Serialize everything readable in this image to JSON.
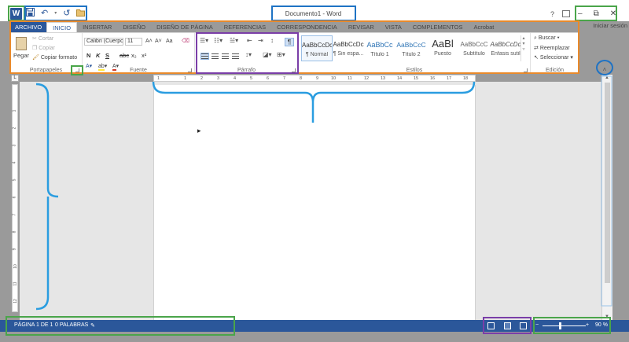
{
  "titlebar": {
    "title": "Documento1 - Word",
    "help": "?",
    "signin": "Iniciar sesión",
    "app_logo": "W",
    "qat_icons": [
      "save-icon",
      "undo-icon",
      "redo-icon",
      "open-folder-icon"
    ],
    "window_buttons": [
      "minimize-icon",
      "restore-icon",
      "close-icon"
    ]
  },
  "tabs": [
    "ARCHIVO",
    "INICIO",
    "INSERTAR",
    "DISEÑO",
    "DISEÑO DE PÁGINA",
    "REFERENCIAS",
    "CORRESPONDENCIA",
    "REVISAR",
    "VISTA",
    "COMPLEMENTOS",
    "Acrobat"
  ],
  "active_tab": "INICIO",
  "ribbon": {
    "clipboard": {
      "label": "Portapapeles",
      "paste": "Pegar",
      "cut": "Cortar",
      "copy": "Copiar",
      "format_painter": "Copiar formato"
    },
    "font": {
      "label": "Fuente",
      "font_name": "Calibri (Cuerpo)",
      "font_size": "11",
      "grow": "A˄",
      "shrink": "A˅",
      "case": "Aa",
      "bold": "N",
      "italic": "K",
      "underline": "S",
      "strike": "abc",
      "subscript": "x₂",
      "superscript": "x²"
    },
    "paragraph": {
      "label": "Párrafo",
      "pilcrow": "¶"
    },
    "styles": {
      "label": "Estilos",
      "items": [
        {
          "sample": "AaBbCcDc",
          "name": "¶ Normal"
        },
        {
          "sample": "AaBbCcDc",
          "name": "¶ Sin espa..."
        },
        {
          "sample": "AaBbCc",
          "name": "Título 1"
        },
        {
          "sample": "AaBbCcC",
          "name": "Título 2"
        },
        {
          "sample": "AaBl",
          "name": "Puesto"
        },
        {
          "sample": "AaBbCcC",
          "name": "Subtítulo"
        },
        {
          "sample": "AaBbCcDc",
          "name": "Énfasis sutil"
        }
      ]
    },
    "editing": {
      "label": "Edición",
      "find": "Buscar",
      "replace": "Reemplazar",
      "select": "Seleccionar"
    }
  },
  "ruler": {
    "h_ticks": [
      "1",
      "1",
      "2",
      "3",
      "4",
      "5",
      "6",
      "7",
      "8",
      "9",
      "10",
      "11",
      "12",
      "13",
      "14",
      "15",
      "16",
      "17",
      "18"
    ],
    "v_ticks": [
      "1",
      "2",
      "3",
      "4",
      "5",
      "6",
      "7",
      "8",
      "9",
      "10",
      "11",
      "12"
    ]
  },
  "statusbar": {
    "page": "PÁGINA 1 DE 1",
    "words": "0 PALABRAS",
    "zoom_minus": "−",
    "zoom_plus": "+",
    "zoom": "90 %"
  },
  "colors": {
    "accent": "#2b579a",
    "annotation_green": "#4aa54a",
    "annotation_blue": "#1f73c4",
    "annotation_orange": "#e98a2b",
    "annotation_purple": "#7a3ea8"
  }
}
